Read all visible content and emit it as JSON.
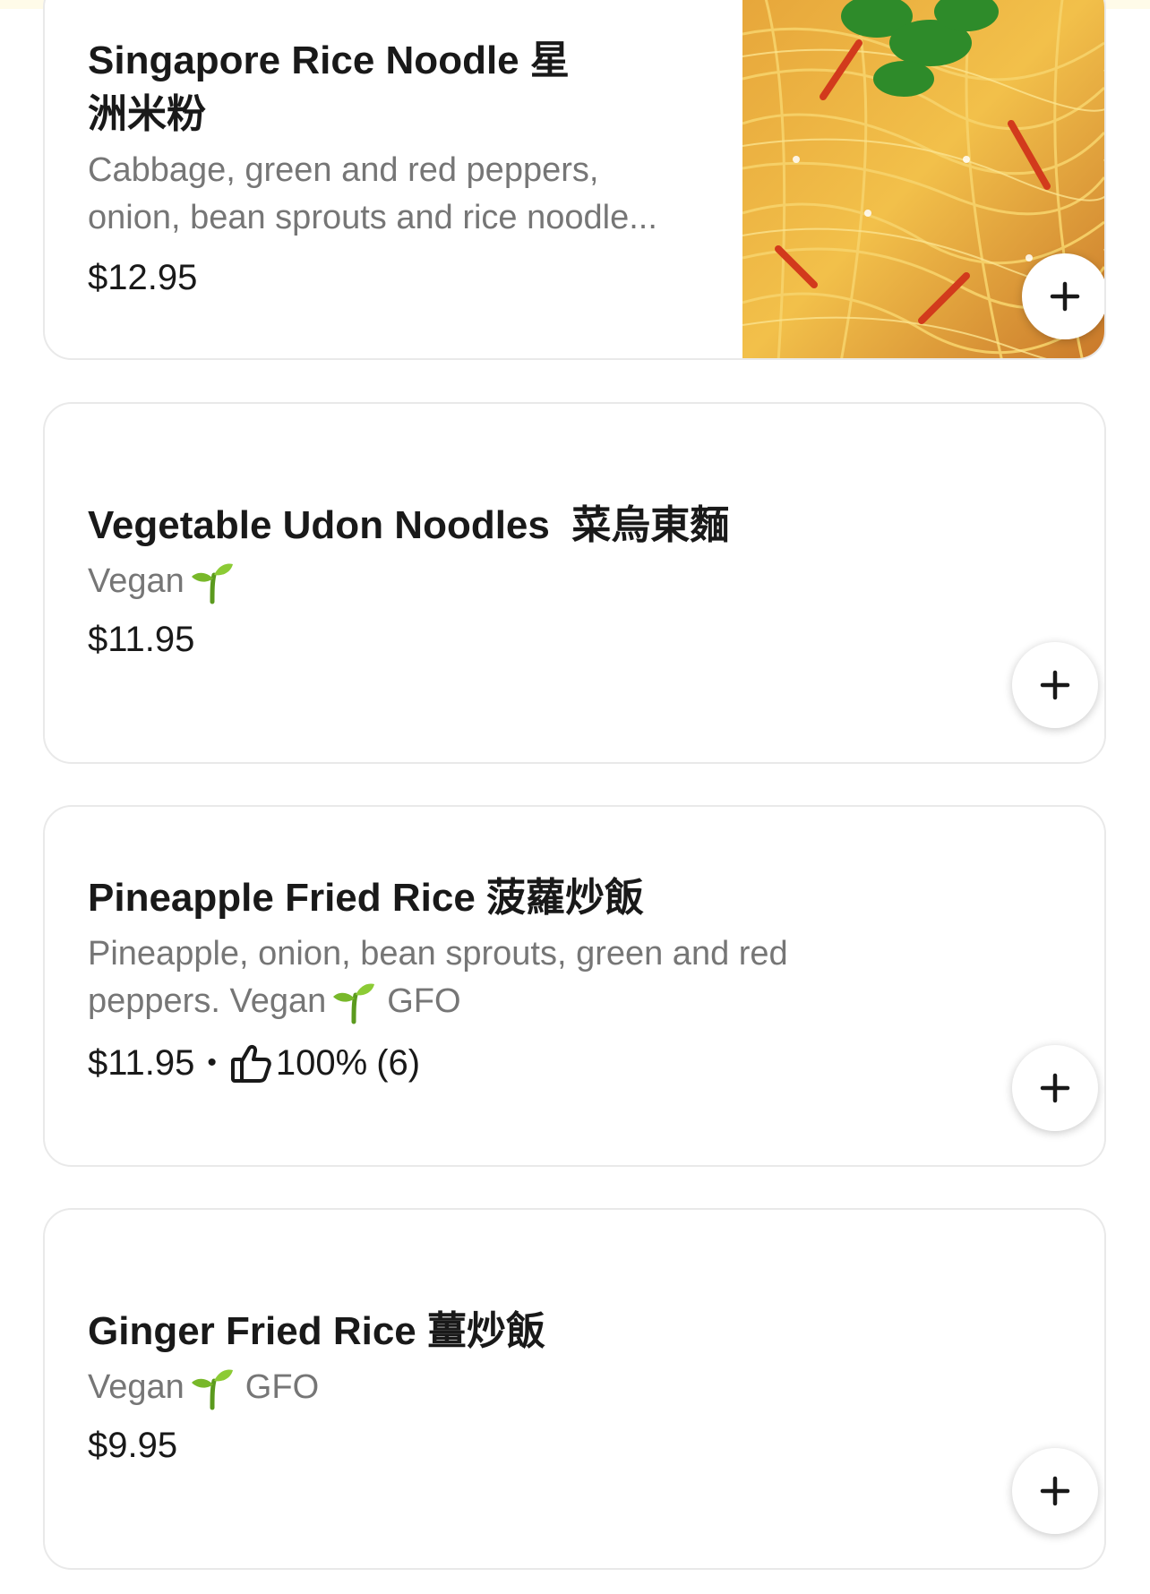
{
  "menu_items": [
    {
      "title": "Singapore Rice Noodle 星\n洲米粉",
      "description": "Cabbage, green and red peppers, onion, bean sprouts and rice noodle...",
      "price": "$12.95",
      "image": "singapore-rice-noodle-photo",
      "add_icon": "plus-icon"
    },
    {
      "title": "Vegetable Udon Noodles  菜烏東麵",
      "description_text": "Vegan",
      "description_icon": "sprout-icon",
      "price": "$11.95",
      "add_icon": "plus-icon"
    },
    {
      "title": "Pineapple Fried Rice 菠蘿炒飯",
      "description_line1": "Pineapple, onion, bean sprouts, green and red",
      "description_line2_before": "peppers. Vegan",
      "description_icon": "sprout-icon",
      "description_line2_after": "GFO",
      "price": "$11.95",
      "separator": "•",
      "rating_icon": "thumbs-up-icon",
      "rating_percent": "100%",
      "rating_count": "(6)",
      "add_icon": "plus-icon"
    },
    {
      "title": "Ginger Fried Rice 薑炒飯",
      "description_before": "Vegan",
      "description_icon": "sprout-icon",
      "description_after": "GFO",
      "price": "$9.95",
      "add_icon": "plus-icon"
    }
  ],
  "colors": {
    "title_text": "#191919",
    "secondary_text": "#767676",
    "card_border": "#e9e9e9",
    "sprout_green": "#78b82a"
  }
}
